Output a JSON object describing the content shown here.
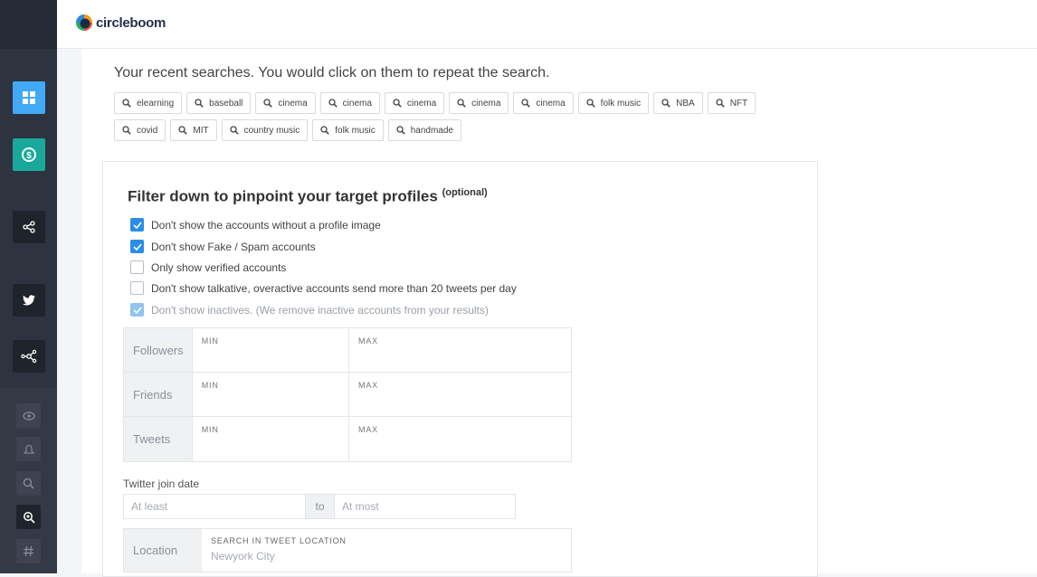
{
  "brand": {
    "name": "circleboom"
  },
  "recent": {
    "title": "Your recent searches. You would click on them to repeat the search.",
    "searches": [
      "elearning",
      "baseball",
      "cinema",
      "cinema",
      "cinema",
      "cinema",
      "cinema",
      "folk music",
      "NBA",
      "NFT",
      "covid",
      "MIT",
      "country music",
      "folk music",
      "handmade"
    ]
  },
  "filter": {
    "title": "Filter down to pinpoint your target profiles",
    "optional": "(optional)",
    "options": [
      {
        "label": "Don't show the accounts without a profile image",
        "checked": true
      },
      {
        "label": "Don't show Fake / Spam accounts",
        "checked": true
      },
      {
        "label": "Only show verified accounts",
        "checked": false
      },
      {
        "label": "Don't show talkative, overactive accounts send more than 20 tweets per day",
        "checked": false
      },
      {
        "label": "Don't show inactives. (We remove inactive accounts from your results)",
        "checked": true,
        "disabled": true
      }
    ],
    "ranges": [
      {
        "label": "Followers",
        "min": "MIN",
        "max": "MAX"
      },
      {
        "label": "Friends",
        "min": "MIN",
        "max": "MAX"
      },
      {
        "label": "Tweets",
        "min": "MIN",
        "max": "MAX"
      }
    ],
    "join_date": {
      "label": "Twitter join date",
      "from_placeholder": "At least",
      "to": "to",
      "to_placeholder": "At most"
    },
    "location": {
      "label": "Location",
      "caption": "SEARCH IN TWEET LOCATION",
      "placeholder": "Newyork City"
    }
  },
  "colors": {
    "sidebar": "#2e3340",
    "accent_blue": "#41a9f5",
    "accent_teal": "#19a99a",
    "checkbox": "#2b8ee6"
  },
  "sidebar_icons": [
    "dashboard-icon",
    "dollar-icon",
    "share-icon",
    "twitter-icon",
    "network-icon",
    "eye-icon",
    "bell-icon",
    "search-icon",
    "location-search-icon",
    "hashtag-icon"
  ]
}
